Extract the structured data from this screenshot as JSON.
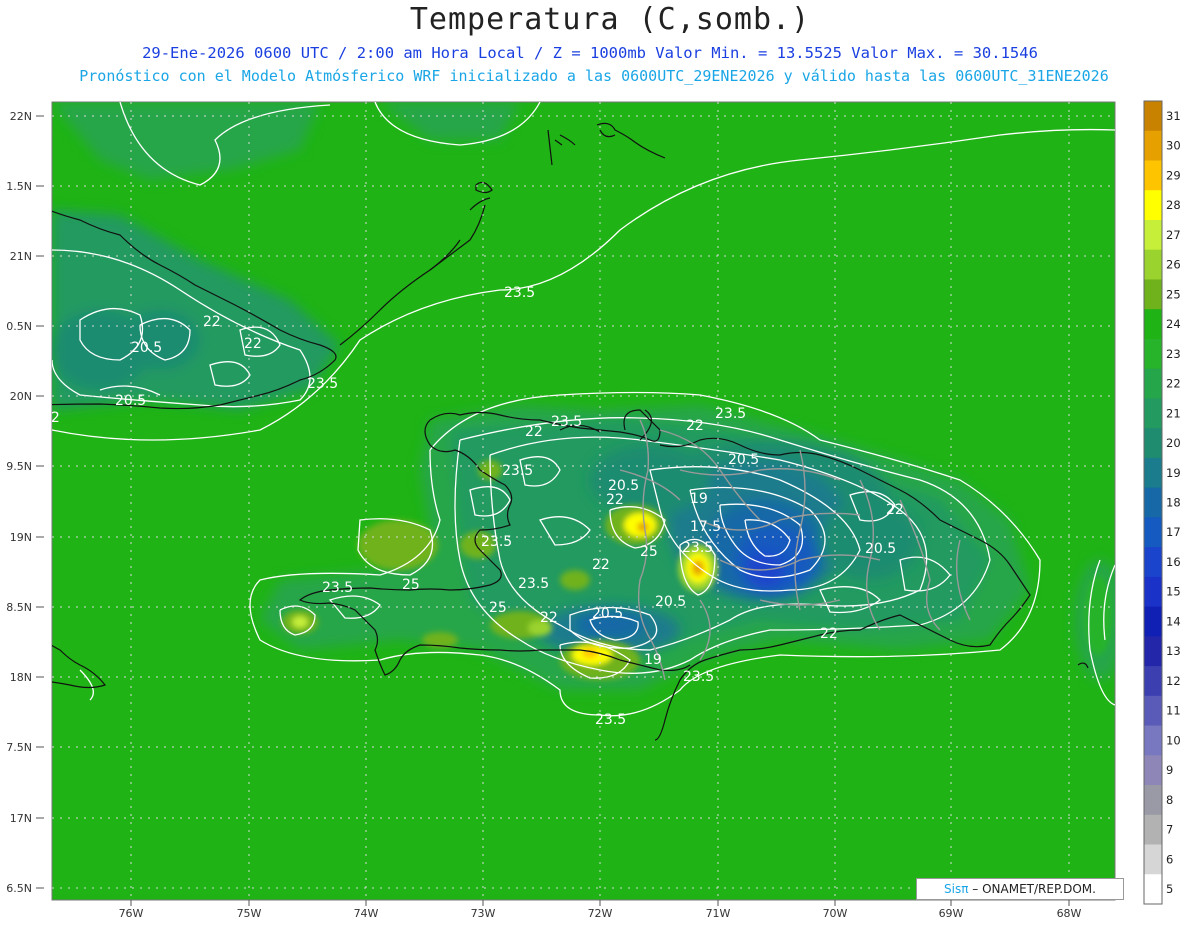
{
  "title": "Temperatura (C,somb.)",
  "subtitle_1": "29-Ene-2026  0600 UTC / 2:00 am Hora Local / Z = 1000mb   Valor Min. = 13.5525  Valor Max. = 30.1546",
  "subtitle_2": "Pronóstico con el Modelo Atmósferico WRF inicializado a las 0600UTC_29ENE2026 y válido hasta las  0600UTC_31ENE2026",
  "lat_labels": [
    "22N",
    "1.5N",
    "21N",
    "0.5N",
    "20N",
    "9.5N",
    "19N",
    "8.5N",
    "18N",
    "7.5N",
    "17N",
    "6.5N"
  ],
  "lon_labels": [
    "76W",
    "75W",
    "74W",
    "73W",
    "72W",
    "71W",
    "70W",
    "69W",
    "68W"
  ],
  "colorbar": {
    "labels": [
      "31",
      "30",
      "29",
      "28",
      "27",
      "26",
      "25",
      "24",
      "23",
      "22",
      "21",
      "20",
      "19",
      "18",
      "17",
      "16",
      "15",
      "14",
      "13",
      "12",
      "11",
      "10",
      "9",
      "8",
      "7",
      "6",
      "5"
    ],
    "colors": [
      "#c98200",
      "#e6a100",
      "#ffc400",
      "#ffff00",
      "#c6ef3a",
      "#9ad32e",
      "#6fb21c",
      "#1fb315",
      "#27b32a",
      "#26a64a",
      "#239a60",
      "#1f8c70",
      "#1a7c8c",
      "#1669a6",
      "#145ac0",
      "#1a44cc",
      "#1a32c8",
      "#1020b4",
      "#2326a8",
      "#3b3fb0",
      "#5a5ab8",
      "#7878c0",
      "#8f86b8",
      "#9a9aa6",
      "#b2b2b2",
      "#d6d6d6",
      "#ffffff"
    ]
  },
  "contour_labels": [
    "23.5",
    "22",
    "20.5",
    "25",
    "19",
    "17.5"
  ],
  "credit": {
    "logo_part1": "Sis",
    "logo_part2": "π",
    "text": "– ONAMET/REP.DOM."
  },
  "colors": {
    "background_field": "#1fb315",
    "contour": "#ffffff",
    "coastline": "#111111",
    "border": "#9a9a9a"
  }
}
